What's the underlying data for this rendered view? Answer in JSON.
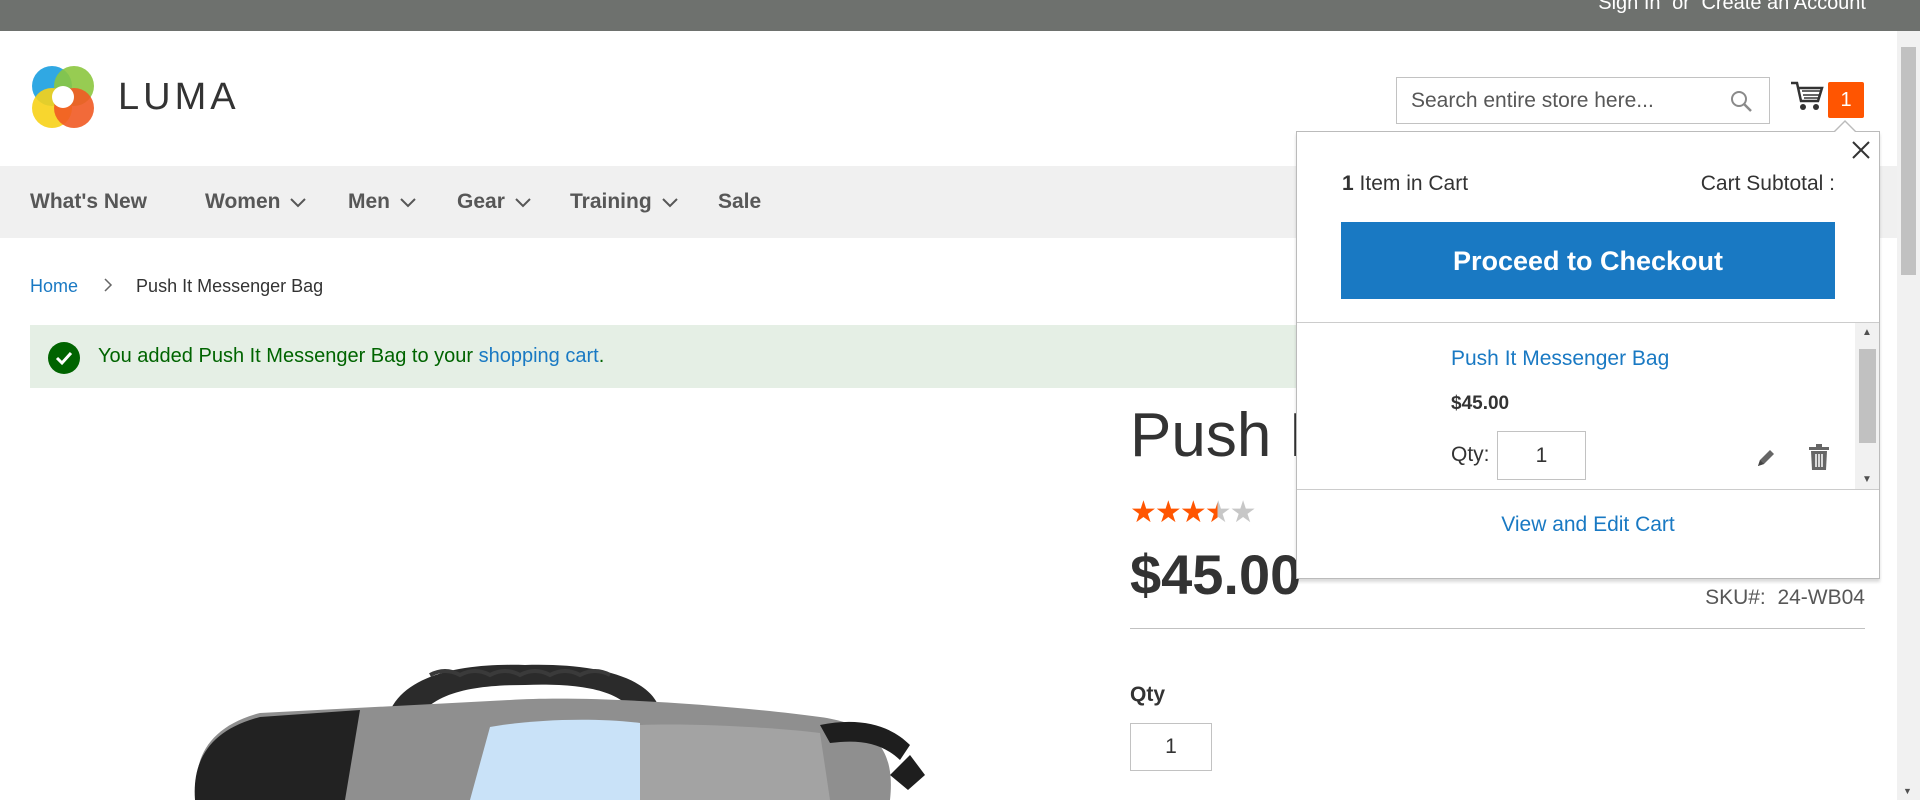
{
  "header": {
    "sign_in": "Sign In",
    "or": "or",
    "create_account": "Create an Account",
    "logo_text": "LUMA",
    "search_placeholder": "Search entire store here...",
    "cart_count": "1"
  },
  "nav": {
    "items": [
      {
        "label": "What's New",
        "has_dropdown": false
      },
      {
        "label": "Women",
        "has_dropdown": true
      },
      {
        "label": "Men",
        "has_dropdown": true
      },
      {
        "label": "Gear",
        "has_dropdown": true
      },
      {
        "label": "Training",
        "has_dropdown": true
      },
      {
        "label": "Sale",
        "has_dropdown": false
      }
    ]
  },
  "breadcrumb": {
    "home": "Home",
    "current": "Push It Messenger Bag"
  },
  "message": {
    "text_before": "You added Push It Messenger Bag to your ",
    "link": "shopping cart",
    "text_after": "."
  },
  "product": {
    "title_visible": "Push I",
    "rating_stars": 3.5,
    "rating_max": 5,
    "price": "$45.00",
    "sku_label": "SKU#:",
    "sku": "24-WB04",
    "qty_label": "Qty",
    "qty_value": "1"
  },
  "minicart": {
    "item_count": "1",
    "item_count_label": "Item in Cart",
    "subtotal_label": "Cart Subtotal :",
    "checkout_label": "Proceed to Checkout",
    "item": {
      "name": "Push It Messenger Bag",
      "price": "$45.00",
      "qty_label": "Qty:",
      "qty_value": "1"
    },
    "view_edit_label": "View and Edit Cart"
  },
  "colors": {
    "accent_blue": "#1979c3",
    "cart_badge": "#ff5501",
    "success_bg": "#e5efe5",
    "success_text": "#006400",
    "star_filled": "#ff5501",
    "star_empty": "#c7c7c7"
  }
}
